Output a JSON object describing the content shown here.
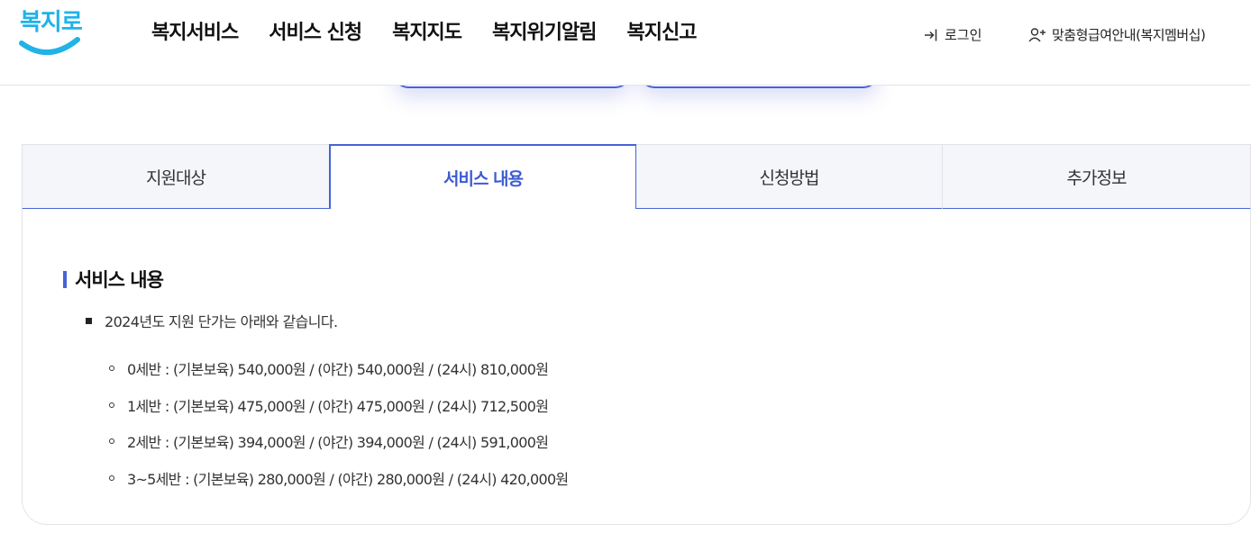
{
  "header": {
    "logo_text": "복지로",
    "nav": [
      "복지서비스",
      "서비스 신청",
      "복지지도",
      "복지위기알림",
      "복지신고"
    ],
    "login_label": "로그인",
    "member_label": "맞춤형급여안내(복지멤버십)"
  },
  "tabs": [
    {
      "label": "지원대상",
      "active": false
    },
    {
      "label": "서비스 내용",
      "active": true
    },
    {
      "label": "신청방법",
      "active": false
    },
    {
      "label": "추가정보",
      "active": false
    }
  ],
  "content": {
    "section_title": "서비스 내용",
    "intro": "2024년도 지원 단가는 아래와 같습니다.",
    "items": [
      "0세반 : (기본보육) 540,000원 / (야간) 540,000원 / (24시) 810,000원",
      "1세반 : (기본보육) 475,000원 / (야간) 475,000원 / (24시) 712,500원",
      "2세반 : (기본보육) 394,000원 / (야간) 394,000원 / (24시) 591,000원",
      "3~5세반 : (기본보육) 280,000원 / (야간) 280,000원 / (24시) 420,000원"
    ]
  },
  "colors": {
    "accent": "#4663d6",
    "logo": "#1fb3e8",
    "tab_bg": "#f5f6fa"
  }
}
